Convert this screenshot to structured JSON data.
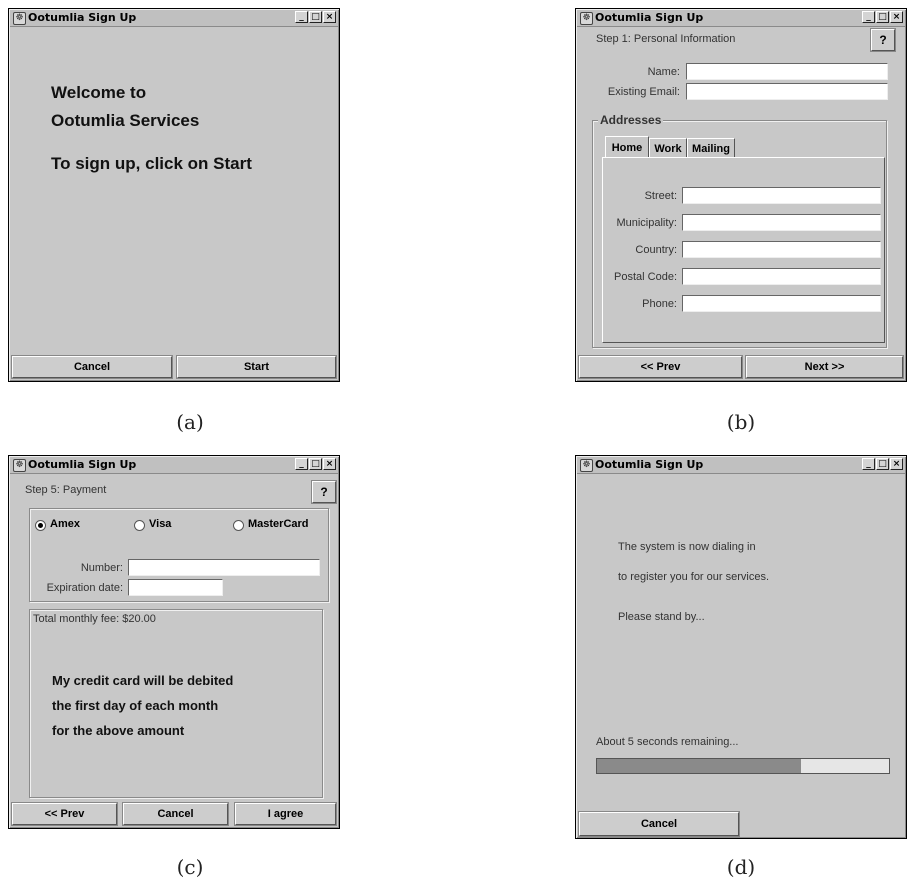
{
  "window_title": "Ootumlia Sign Up",
  "title_buttons": [
    "_",
    "□",
    "×"
  ],
  "captions": [
    "(a)",
    "(b)",
    "(c)",
    "(d)"
  ],
  "panel_a": {
    "welcome_line1": "Welcome to",
    "welcome_line2": "Ootumlia Services",
    "instruction": "To sign up, click on Start",
    "cancel_label": "Cancel",
    "start_label": "Start"
  },
  "panel_b": {
    "step": "Step 1: Personal Information",
    "help_label": "?",
    "name_label": "Name:",
    "email_label": "Existing Email:",
    "addresses_label": "Addresses",
    "tabs": [
      "Home",
      "Work",
      "Mailing"
    ],
    "street_label": "Street:",
    "municipality_label": "Municipality:",
    "country_label": "Country:",
    "postal_label": "Postal Code:",
    "phone_label": "Phone:",
    "prev_label": "<< Prev",
    "next_label": "Next >>"
  },
  "panel_c": {
    "step": "Step 5: Payment",
    "help_label": "?",
    "radio_amex": "Amex",
    "radio_visa": "Visa",
    "radio_mastercard": "MasterCard",
    "number_label": "Number:",
    "expiration_label": "Expiration date:",
    "fee": "Total monthly fee: $20.00",
    "terms_line1": "My credit card will be debited",
    "terms_line2": "the first day of each month",
    "terms_line3": "for the above amount",
    "prev_label": "<< Prev",
    "cancel_label": "Cancel",
    "agree_label": "I agree"
  },
  "panel_d": {
    "line1": "The system is now dialing in",
    "line2": "to register you for our services.",
    "line3": "Please stand by...",
    "remaining": "About 5 seconds remaining...",
    "progress_fraction": 0.7,
    "cancel_label": "Cancel"
  }
}
